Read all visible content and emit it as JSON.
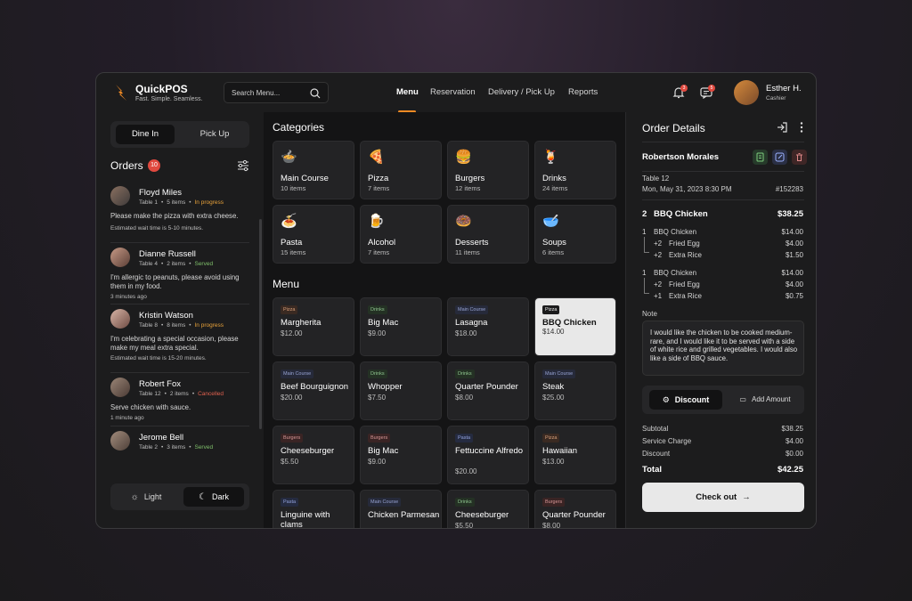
{
  "app": {
    "name": "QuickPOS",
    "tagline": "Fast. Simple. Seamless."
  },
  "search": {
    "placeholder": "Search Menu..."
  },
  "nav": [
    {
      "label": "Menu",
      "active": true
    },
    {
      "label": "Reservation"
    },
    {
      "label": "Delivery / Pick Up"
    },
    {
      "label": "Reports"
    }
  ],
  "header": {
    "notifications_count": "3",
    "messages_count": "5"
  },
  "user": {
    "name": "Esther H.",
    "role": "Cashier"
  },
  "order_mode": {
    "options": [
      "Dine In",
      "Pick Up"
    ],
    "selected": "Dine In"
  },
  "orders": {
    "title": "Orders",
    "count": "10",
    "items": [
      {
        "name": "Floyd Miles",
        "table": "Table 1",
        "items": "5 items",
        "status": "In progress",
        "message": "Please make the pizza with extra cheese.",
        "time": "Estimated wait time is 5-10 minutes."
      },
      {
        "name": "Dianne Russell",
        "table": "Table 4",
        "items": "2 items",
        "status": "Served",
        "message": "I'm allergic to peanuts, please avoid using them in my food.",
        "time": "3 minutes ago"
      },
      {
        "name": "Kristin Watson",
        "table": "Table 8",
        "items": "8 items",
        "status": "In progress",
        "message": "I'm celebrating a special occasion, please make my meal extra special.",
        "time": "Estimated wait time is 15-20 minutes."
      },
      {
        "name": "Robert Fox",
        "table": "Table 12",
        "items": "2 items",
        "status": "Cancelled",
        "message": "Serve chicken with sauce.",
        "time": "1 minute ago"
      },
      {
        "name": "Jerome Bell",
        "table": "Table 2",
        "items": "3 items",
        "status": "Served",
        "message": "",
        "time": ""
      }
    ]
  },
  "theme": {
    "light": "Light",
    "dark": "Dark",
    "selected": "Dark"
  },
  "categories": {
    "title": "Categories",
    "items": [
      {
        "name": "Main Course",
        "count": "10 items",
        "icon": "🍲"
      },
      {
        "name": "Pizza",
        "count": "7 items",
        "icon": "🍕"
      },
      {
        "name": "Burgers",
        "count": "12 items",
        "icon": "🍔"
      },
      {
        "name": "Drinks",
        "count": "24 items",
        "icon": "🍹"
      },
      {
        "name": "Pasta",
        "count": "15 items",
        "icon": "🍝"
      },
      {
        "name": "Alcohol",
        "count": "7 items",
        "icon": "🍺"
      },
      {
        "name": "Desserts",
        "count": "11 items",
        "icon": "🍩"
      },
      {
        "name": "Soups",
        "count": "6 items",
        "icon": "🥣"
      }
    ]
  },
  "menu": {
    "title": "Menu",
    "items": [
      {
        "tag": "Pizza",
        "name": "Margherita",
        "price": "$12.00"
      },
      {
        "tag": "Drinks",
        "name": "Big Mac",
        "price": "$9.00"
      },
      {
        "tag": "Main Course",
        "name": "Lasagna",
        "price": "$18.00"
      },
      {
        "tag": "Pizza",
        "name": "BBQ Chicken",
        "price": "$14.00",
        "selected": true
      },
      {
        "tag": "Main Course",
        "name": "Beef Bourguignon",
        "price": "$20.00"
      },
      {
        "tag": "Drinks",
        "name": "Whopper",
        "price": "$7.50"
      },
      {
        "tag": "Drinks",
        "name": "Quarter Pounder",
        "price": "$8.00"
      },
      {
        "tag": "Main Course",
        "name": "Steak",
        "price": "$25.00"
      },
      {
        "tag": "Burgers",
        "name": "Cheeseburger",
        "price": "$5.50"
      },
      {
        "tag": "Burgers",
        "name": "Big Mac",
        "price": "$9.00"
      },
      {
        "tag": "Pasta",
        "name": "Fettuccine Alfredo",
        "price": "$20.00"
      },
      {
        "tag": "Pizza",
        "name": "Hawaiian",
        "price": "$13.00"
      },
      {
        "tag": "Pasta",
        "name": "Linguine with clams",
        "price": ""
      },
      {
        "tag": "Main Course",
        "name": "Chicken Parmesan",
        "price": ""
      },
      {
        "tag": "Drinks",
        "name": "Cheeseburger",
        "price": "$5.50"
      },
      {
        "tag": "Burgers",
        "name": "Quarter Pounder",
        "price": "$8.00"
      }
    ]
  },
  "order_details": {
    "title": "Order Details",
    "customer": "Robertson Morales",
    "table": "Table 12",
    "datetime": "Mon, May 31, 2023 8:30 PM",
    "order_id": "#152283",
    "item": {
      "qty": "2",
      "name": "BBQ Chicken",
      "total": "$38.25"
    },
    "groups": [
      {
        "qty": "1",
        "name": "BBQ Chicken",
        "price": "$14.00",
        "addons": [
          {
            "qty": "+2",
            "name": "Fried Egg",
            "price": "$4.00"
          },
          {
            "qty": "+2",
            "name": "Extra Rice",
            "price": "$1.50"
          }
        ]
      },
      {
        "qty": "1",
        "name": "BBQ Chicken",
        "price": "$14.00",
        "addons": [
          {
            "qty": "+2",
            "name": "Fried Egg",
            "price": "$4.00"
          },
          {
            "qty": "+1",
            "name": "Extra Rice",
            "price": "$0.75"
          }
        ]
      }
    ],
    "note_label": "Note",
    "note": "I would like the chicken to be cooked medium-rare, and I would like it to be served with a side of white rice and grilled vegetables. I would also like a side of BBQ sauce.",
    "discount_label": "Discount",
    "add_amount_label": "Add Amount",
    "subtotal_label": "Subtotal",
    "subtotal": "$38.25",
    "service_label": "Service Charge",
    "service": "$4.00",
    "discount_row_label": "Discount",
    "discount": "$0.00",
    "total_label": "Total",
    "total": "$42.25",
    "checkout_label": "Check out"
  },
  "colors": {
    "accent": "#f08a24",
    "badge": "#e0493f",
    "in_progress": "#e8a23a",
    "served": "#7fbf6a",
    "cancelled": "#e0614f"
  }
}
